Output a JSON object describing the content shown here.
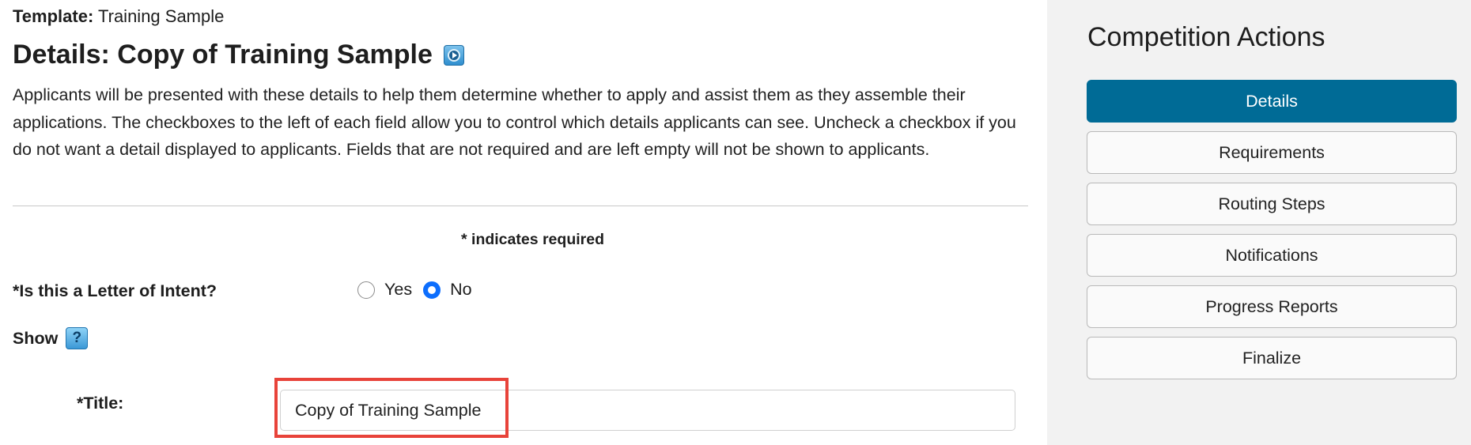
{
  "template": {
    "label": "Template:",
    "value": "Training Sample"
  },
  "page_title": "Details: Copy of Training Sample",
  "description": "Applicants will be presented with these details to help them determine whether to apply and assist them as they assemble their applications. The checkboxes to the left of each field allow you to control which details applicants can see. Uncheck a checkbox if you do not want a detail displayed to applicants. Fields that are not required and are left empty will not be shown to applicants.",
  "required_note": "* indicates required",
  "letter_of_intent": {
    "label": "*Is this a Letter of Intent?",
    "options": [
      "Yes",
      "No"
    ],
    "selected": "No"
  },
  "show": {
    "label": "Show",
    "help_icon": "?"
  },
  "title_field": {
    "label": "*Title:",
    "value": "Copy of Training Sample"
  },
  "sidebar": {
    "title": "Competition Actions",
    "actions": [
      "Details",
      "Requirements",
      "Routing Steps",
      "Notifications",
      "Progress Reports",
      "Finalize"
    ],
    "active": "Details"
  },
  "colors": {
    "active_button": "#006b96",
    "radio_selected": "#0d6efd",
    "highlight": "#e8433a",
    "sidebar_bg": "#f2f2f2"
  }
}
